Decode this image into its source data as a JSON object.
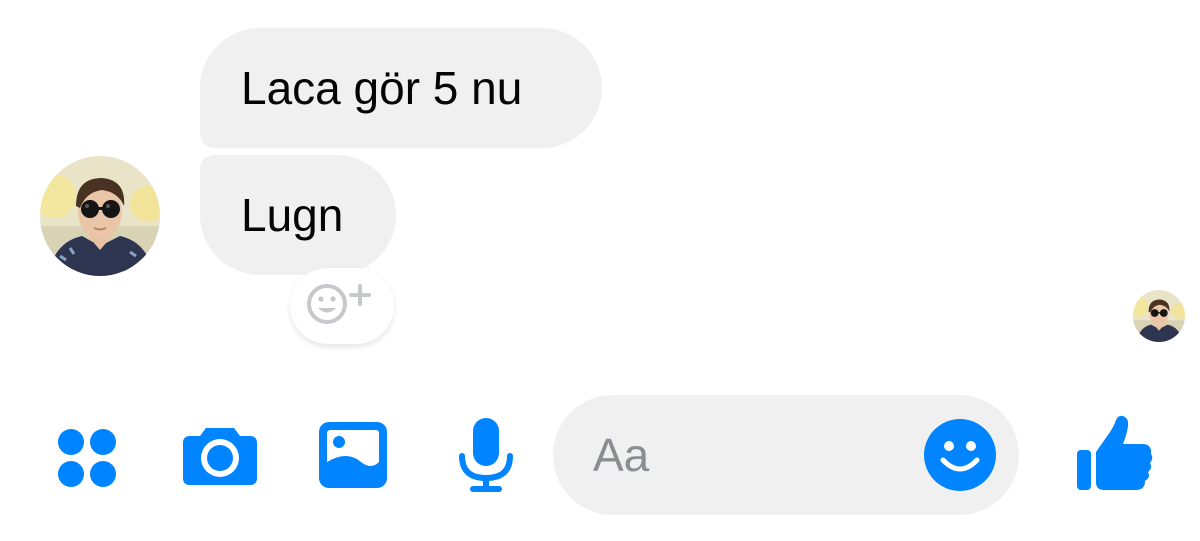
{
  "thread": {
    "messages": [
      {
        "text": "Laca gör 5 nu"
      },
      {
        "text": "Lugn"
      }
    ]
  },
  "icons": {
    "avatar": "contact-avatar",
    "seen": "seen-avatar",
    "reaction": "add-reaction-icon",
    "more": "four-dots-icon",
    "camera": "camera-icon",
    "gallery": "image-icon",
    "voice": "microphone-icon",
    "emoji": "smiley-icon",
    "like": "thumbs-up-icon"
  },
  "composer": {
    "placeholder": "Aa",
    "value": ""
  },
  "colors": {
    "accent": "#0084ff",
    "bubble_bg": "#f0f0f1",
    "text": "#050505",
    "placeholder": "#8a8d91"
  }
}
